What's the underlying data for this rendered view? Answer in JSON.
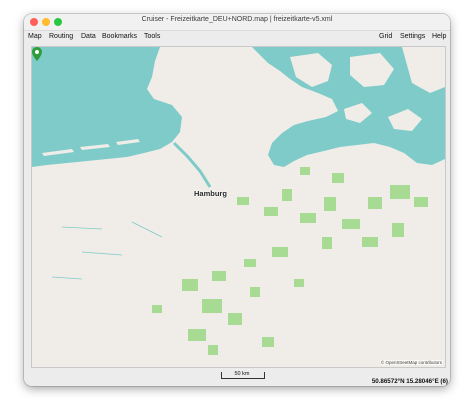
{
  "window": {
    "title": "Cruiser - Freizeitkarte_DEU+NORD.map | freizeitkarte-v5.xml"
  },
  "menu": {
    "left": [
      "Map",
      "Routing",
      "Data",
      "Bookmarks",
      "Tools"
    ],
    "right": [
      "Grid",
      "Settings",
      "Help"
    ]
  },
  "map": {
    "city_label": "Hamburg",
    "attribution": "© OpenStreetMap contributors",
    "colors": {
      "land": "#f0ede8",
      "water": "#7fcbc9",
      "forest": "#a7db94",
      "pin": "#2f9e3a"
    },
    "icons": [
      "map-pin-icon"
    ]
  },
  "status": {
    "scale_label": "50 km",
    "coordinates": "50.86572°N 15.28046°E (6)"
  }
}
